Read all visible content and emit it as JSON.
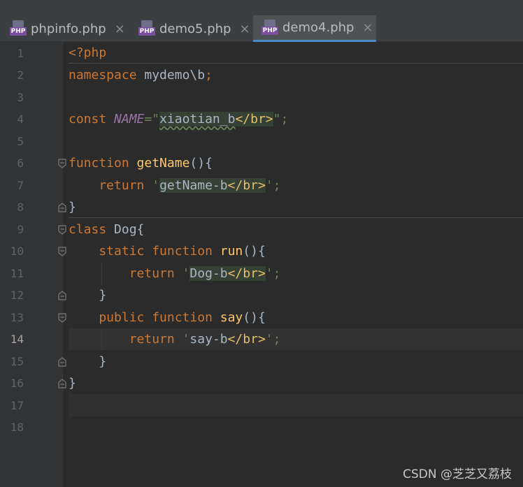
{
  "tabs": [
    {
      "label": "phpinfo.php",
      "icon": "php-file-icon",
      "active": false
    },
    {
      "label": "demo5.php",
      "icon": "php-file-icon",
      "active": false
    },
    {
      "label": "demo4.php",
      "icon": "php-file-icon",
      "active": true
    }
  ],
  "php_icon_text": "PHP",
  "close_glyph": "×",
  "line_numbers": [
    "1",
    "2",
    "3",
    "4",
    "5",
    "6",
    "7",
    "8",
    "9",
    "10",
    "11",
    "12",
    "13",
    "14",
    "15",
    "16",
    "17",
    "18"
  ],
  "current_line": "14",
  "code": {
    "l1": {
      "t": "<?php"
    },
    "l2": {
      "a": "namespace",
      "b": " mydemo\\b",
      "c": ";"
    },
    "l4": {
      "a": "const ",
      "b": "NAME",
      "c": "=\"",
      "d": "xiaotian_b",
      "e": "</br>",
      "f": "\";"
    },
    "l6": {
      "a": "function ",
      "b": "getName",
      "c": "(){"
    },
    "l7": {
      "a": "    return ",
      "b": "'",
      "c": "getName-b",
      "d": "</br>",
      "e": "';"
    },
    "l8": {
      "t": "}"
    },
    "l9": {
      "a": "class ",
      "b": "Dog{"
    },
    "l10": {
      "a": "    static function ",
      "b": "run",
      "c": "(){"
    },
    "l11": {
      "a": "        return ",
      "b": "'",
      "c": "Dog-b",
      "d": "</br>",
      "e": "';"
    },
    "l12": {
      "t": "    }"
    },
    "l13": {
      "a": "    public function ",
      "b": "say",
      "c": "(){"
    },
    "l14": {
      "a": "        return ",
      "b": "'",
      "c": "say-b",
      "d": "</br>",
      "e": "';"
    },
    "l15": {
      "t": "    }"
    },
    "l16": {
      "t": "}"
    }
  },
  "watermark": "CSDN @芝芝又荔枝",
  "colors": {
    "keyword": "#cc7832",
    "function": "#ffc66d",
    "string": "#6a8759",
    "tag": "#e8bf6a",
    "constant": "#9876aa",
    "text": "#a9b7c6",
    "background": "#2b2b2b"
  }
}
